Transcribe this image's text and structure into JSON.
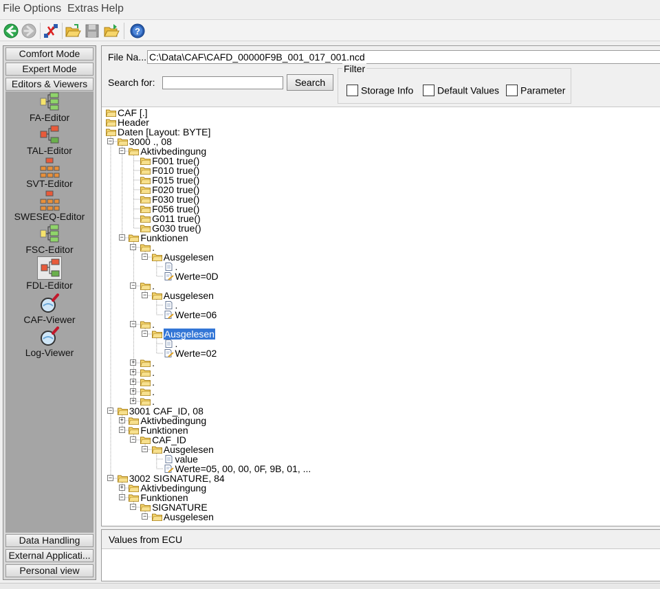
{
  "menu": [
    "File",
    "Options",
    "Extras",
    "Help"
  ],
  "toolbar": {
    "icons": [
      "back-arrow-icon",
      "forward-arrow-icon",
      "connection-icon",
      "open-folder-icon",
      "save-icon",
      "open-folder-arrow-icon",
      "help-icon"
    ]
  },
  "sidebar": {
    "top_buttons": [
      "Comfort Mode",
      "Expert Mode",
      "Editors & Viewers"
    ],
    "tools": [
      {
        "label": "FA-Editor",
        "icon": "fa-editor-icon"
      },
      {
        "label": "TAL-Editor",
        "icon": "tal-editor-icon"
      },
      {
        "label": "SVT-Editor",
        "icon": "svt-editor-icon"
      },
      {
        "label": "SWESEQ-Editor",
        "icon": "sweseq-editor-icon"
      },
      {
        "label": "FSC-Editor",
        "icon": "fsc-editor-icon"
      },
      {
        "label": "FDL-Editor",
        "icon": "fdl-editor-icon"
      },
      {
        "label": "CAF-Viewer",
        "icon": "caf-viewer-icon"
      },
      {
        "label": "Log-Viewer",
        "icon": "log-viewer-icon"
      }
    ],
    "bottom_buttons": [
      "Data Handling",
      "External Applicati...",
      "Personal view"
    ]
  },
  "file": {
    "label": "File Na...",
    "value": "C:\\Data\\CAF\\CAFD_00000F9B_001_017_001.ncd"
  },
  "search": {
    "label": "Search for:",
    "value": "",
    "button": "Search"
  },
  "filter": {
    "title": "Filter",
    "options": [
      "Storage Info",
      "Default Values",
      "Parameter"
    ]
  },
  "tree": [
    {
      "text": "CAF [.]",
      "level": 0,
      "icon": "folder",
      "exp": "none"
    },
    {
      "text": "Header",
      "level": 0,
      "icon": "folder",
      "exp": "plus"
    },
    {
      "text": "Daten [Layout: BYTE]",
      "level": 0,
      "icon": "folder",
      "exp": "minus"
    },
    {
      "text": "3000 ., 08",
      "level": 1,
      "icon": "folder",
      "exp": "minus"
    },
    {
      "text": "Aktivbedingung",
      "level": 2,
      "icon": "folder",
      "exp": "minus"
    },
    {
      "text": "F001 true()",
      "level": 3,
      "icon": "folder",
      "exp": "none"
    },
    {
      "text": "F010 true()",
      "level": 3,
      "icon": "folder",
      "exp": "none"
    },
    {
      "text": "F015 true()",
      "level": 3,
      "icon": "folder",
      "exp": "none"
    },
    {
      "text": "F020 true()",
      "level": 3,
      "icon": "folder",
      "exp": "none"
    },
    {
      "text": "F030 true()",
      "level": 3,
      "icon": "folder",
      "exp": "none"
    },
    {
      "text": "F056 true()",
      "level": 3,
      "icon": "folder",
      "exp": "none"
    },
    {
      "text": "G011 true()",
      "level": 3,
      "icon": "folder",
      "exp": "none"
    },
    {
      "text": "G030 true()",
      "level": 3,
      "icon": "folder",
      "exp": "none"
    },
    {
      "text": "Funktionen",
      "level": 2,
      "icon": "folder",
      "exp": "minus"
    },
    {
      "text": ".",
      "level": 3,
      "icon": "folder",
      "exp": "minus"
    },
    {
      "text": "Ausgelesen",
      "level": 4,
      "icon": "folder",
      "exp": "minus"
    },
    {
      "text": ".",
      "level": 5,
      "icon": "doc",
      "exp": "none"
    },
    {
      "text": "Werte=0D",
      "level": 5,
      "icon": "doc-edit",
      "exp": "none"
    },
    {
      "text": ".",
      "level": 3,
      "icon": "folder",
      "exp": "minus"
    },
    {
      "text": "Ausgelesen",
      "level": 4,
      "icon": "folder",
      "exp": "minus"
    },
    {
      "text": ".",
      "level": 5,
      "icon": "doc",
      "exp": "none"
    },
    {
      "text": "Werte=06",
      "level": 5,
      "icon": "doc-edit",
      "exp": "none"
    },
    {
      "text": ".",
      "level": 3,
      "icon": "folder",
      "exp": "minus"
    },
    {
      "text": "Ausgelesen",
      "level": 4,
      "icon": "folder",
      "exp": "minus",
      "selected": true
    },
    {
      "text": ".",
      "level": 5,
      "icon": "doc",
      "exp": "none"
    },
    {
      "text": "Werte=02",
      "level": 5,
      "icon": "doc-edit",
      "exp": "none"
    },
    {
      "text": ".",
      "level": 3,
      "icon": "folder",
      "exp": "plus"
    },
    {
      "text": ".",
      "level": 3,
      "icon": "folder",
      "exp": "plus"
    },
    {
      "text": ".",
      "level": 3,
      "icon": "folder",
      "exp": "plus"
    },
    {
      "text": ".",
      "level": 3,
      "icon": "folder",
      "exp": "plus"
    },
    {
      "text": ".",
      "level": 3,
      "icon": "folder",
      "exp": "plus"
    },
    {
      "text": "3001 CAF_ID, 08",
      "level": 1,
      "icon": "folder",
      "exp": "minus"
    },
    {
      "text": "Aktivbedingung",
      "level": 2,
      "icon": "folder",
      "exp": "plus"
    },
    {
      "text": "Funktionen",
      "level": 2,
      "icon": "folder",
      "exp": "minus"
    },
    {
      "text": "CAF_ID",
      "level": 3,
      "icon": "folder",
      "exp": "minus"
    },
    {
      "text": "Ausgelesen",
      "level": 4,
      "icon": "folder",
      "exp": "minus"
    },
    {
      "text": "value",
      "level": 5,
      "icon": "doc",
      "exp": "none"
    },
    {
      "text": "Werte=05, 00, 00, 0F, 9B, 01,  ...",
      "level": 5,
      "icon": "doc-edit",
      "exp": "none"
    },
    {
      "text": "3002 SIGNATURE, 84",
      "level": 1,
      "icon": "folder",
      "exp": "minus"
    },
    {
      "text": "Aktivbedingung",
      "level": 2,
      "icon": "folder",
      "exp": "plus"
    },
    {
      "text": "Funktionen",
      "level": 2,
      "icon": "folder",
      "exp": "minus"
    },
    {
      "text": "SIGNATURE",
      "level": 3,
      "icon": "folder",
      "exp": "minus"
    },
    {
      "text": "Ausgelesen",
      "level": 4,
      "icon": "folder",
      "exp": "minus"
    }
  ],
  "values_panel": {
    "title": "Values from ECU"
  },
  "colors": {
    "selection": "#3376d6",
    "sidebar_bg": "#a5a5a5",
    "folder": "#f3d36b"
  }
}
